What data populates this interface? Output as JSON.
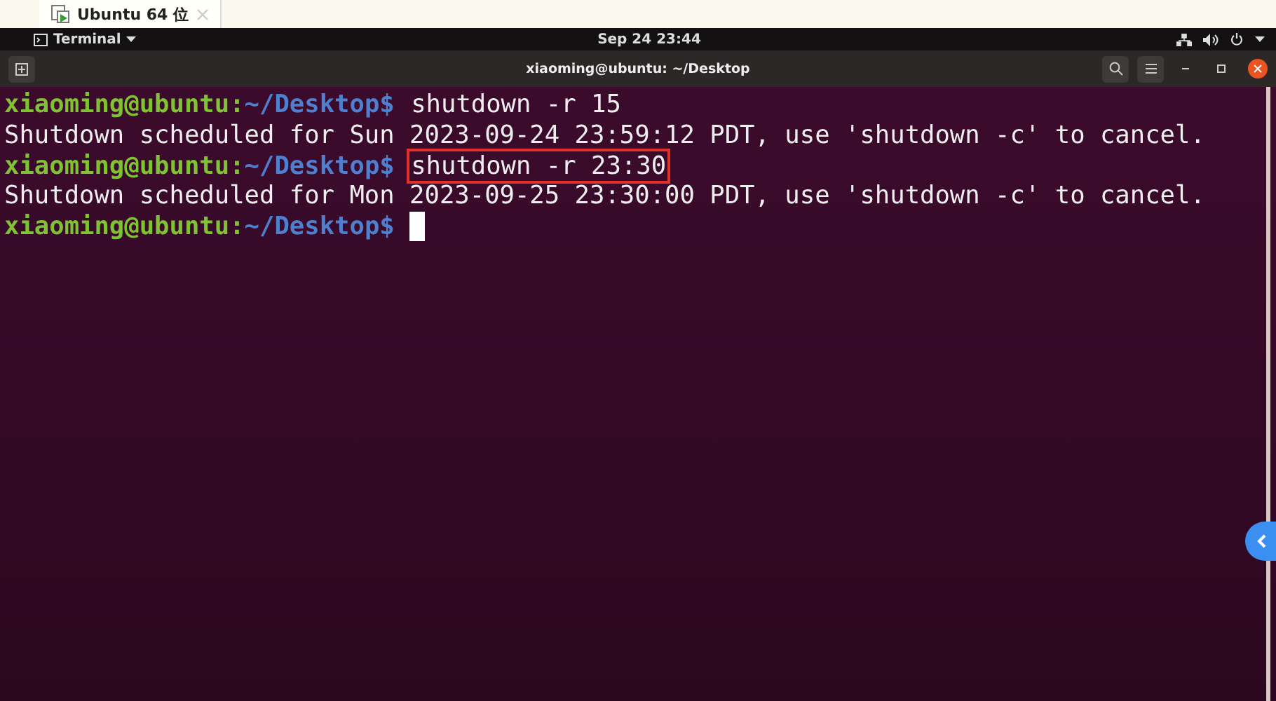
{
  "vm_tabs": [
    {
      "label": "Ubuntu 64 位",
      "selected": true
    }
  ],
  "top_bar": {
    "app_menu": "Terminal",
    "clock": "Sep 24  23:44"
  },
  "window": {
    "title": "xiaoming@ubuntu: ~/Desktop"
  },
  "terminal": {
    "lines": [
      {
        "kind": "prompt",
        "user": "xiaoming@ubuntu:",
        "path": "~/Desktop$",
        "command": "shutdown -r 15",
        "highlighted": false
      },
      {
        "kind": "output",
        "text": "Shutdown scheduled for Sun 2023-09-24 23:59:12 PDT, use 'shutdown -c' to cancel."
      },
      {
        "kind": "prompt",
        "user": "xiaoming@ubuntu:",
        "path": "~/Desktop$",
        "command": "shutdown -r 23:30",
        "highlighted": true
      },
      {
        "kind": "output",
        "text": "Shutdown scheduled for Mon 2023-09-25 23:30:00 PDT, use 'shutdown -c' to cancel."
      },
      {
        "kind": "prompt",
        "user": "xiaoming@ubuntu:",
        "path": "~/Desktop$",
        "cursor": true
      }
    ]
  }
}
